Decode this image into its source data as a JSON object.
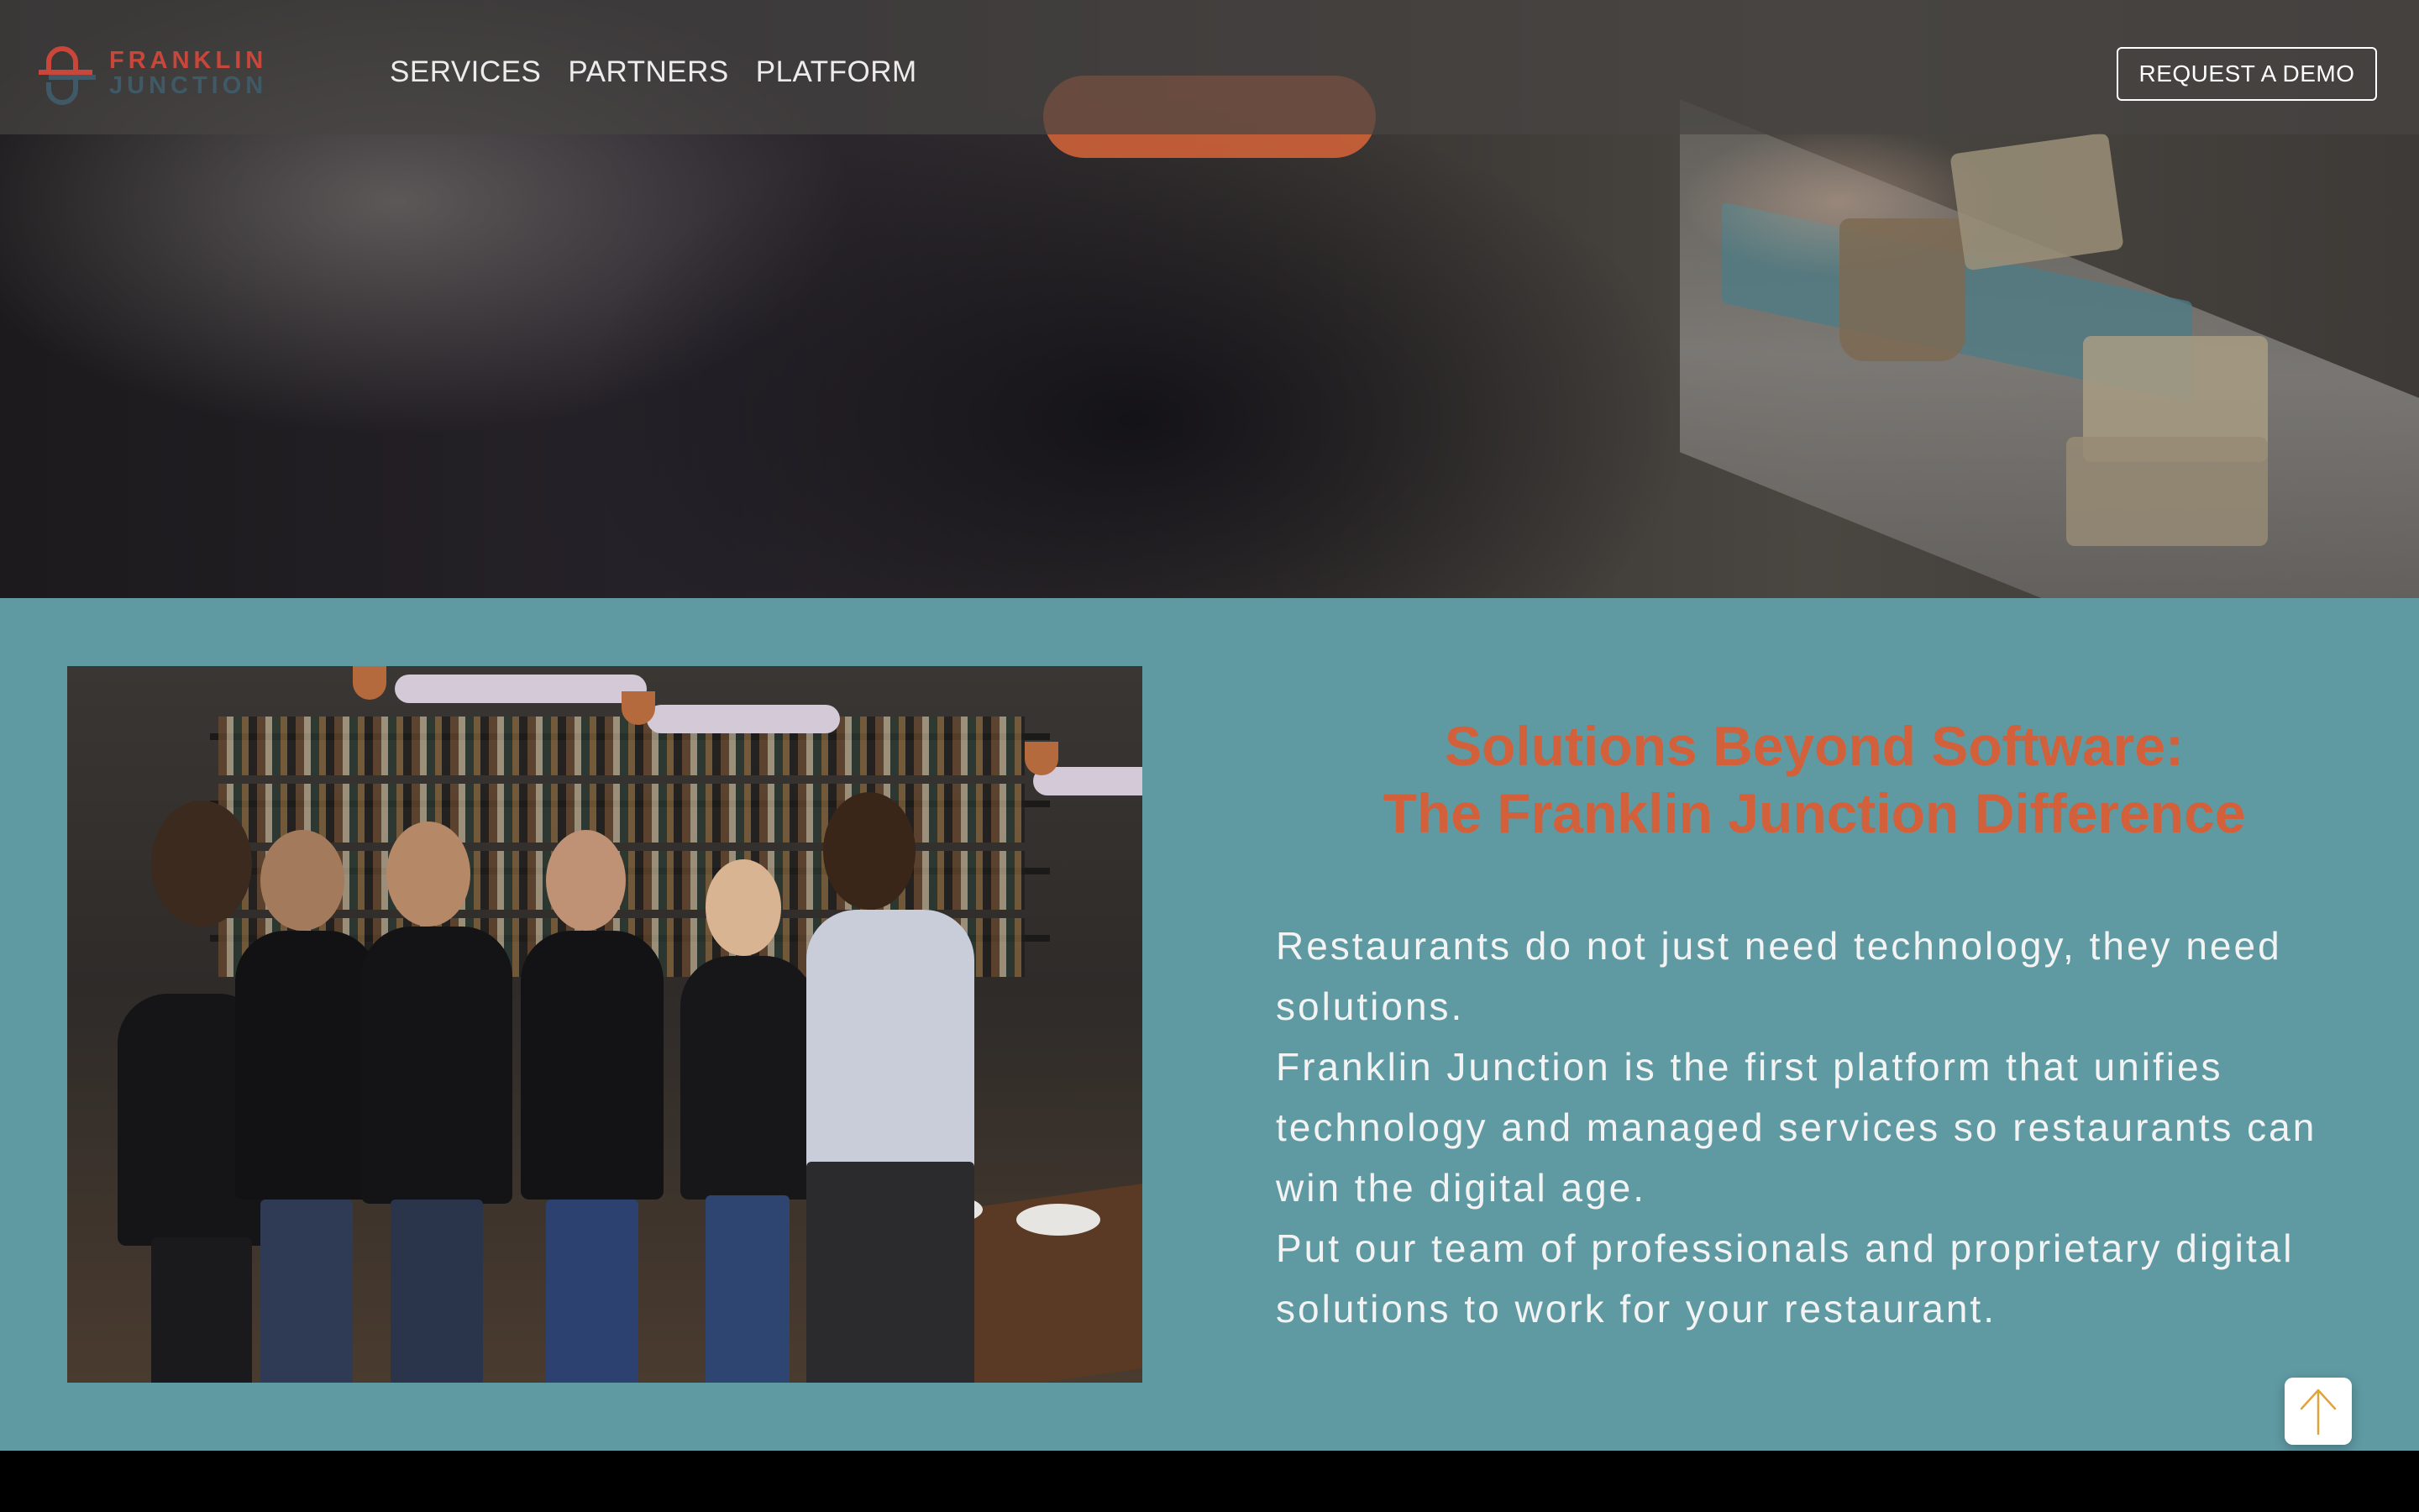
{
  "brand": {
    "name_line1": "FRANKLIN",
    "name_line2": "JUNCTION",
    "logo_red": "#c9473a",
    "logo_slate": "#3f5a66"
  },
  "nav": {
    "items": [
      {
        "label": "SERVICES"
      },
      {
        "label": "PARTNERS"
      },
      {
        "label": "PLATFORM"
      }
    ],
    "demo_button": "REQUEST A DEMO"
  },
  "hero": {
    "cta_color": "#d8653a"
  },
  "solutions": {
    "heading_line1": "Solutions Beyond Software:",
    "heading_line2": "The Franklin Junction Difference",
    "paragraph1": "Restaurants do not just need technology, they need solutions.",
    "paragraph2": "Franklin Junction is the first platform that unifies technology and managed services so restaurants can win the digital age.",
    "paragraph3": "Put our team of professionals and proprietary digital solutions to work for your restaurant.",
    "background_color": "#5f9aa3",
    "heading_color": "#d2603a"
  },
  "scroll_top": {
    "icon": "arrow-up-icon",
    "icon_color": "#e0a43a"
  }
}
